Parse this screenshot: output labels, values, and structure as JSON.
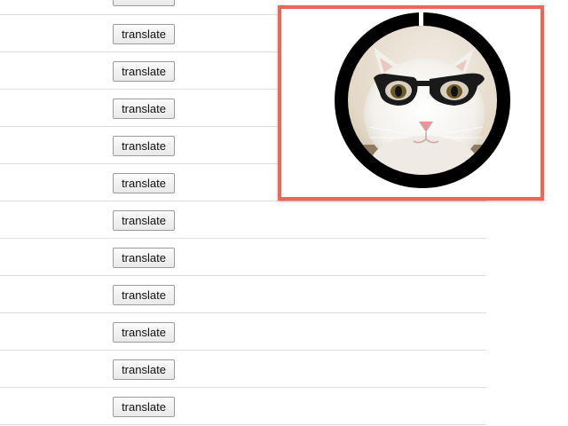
{
  "list": {
    "rows": [
      {
        "button_label": "translate"
      },
      {
        "button_label": "translate"
      },
      {
        "button_label": "translate"
      },
      {
        "button_label": "translate"
      },
      {
        "button_label": "translate"
      },
      {
        "button_label": "translate"
      },
      {
        "button_label": "translate"
      },
      {
        "button_label": "translate"
      },
      {
        "button_label": "translate"
      },
      {
        "button_label": "translate"
      },
      {
        "button_label": "translate"
      },
      {
        "button_label": "translate"
      }
    ]
  },
  "avatar": {
    "image": "white cat wearing black glasses",
    "icon": "avatar-photo",
    "ring_color": "#000000",
    "highlight_color": "#ee6655"
  }
}
